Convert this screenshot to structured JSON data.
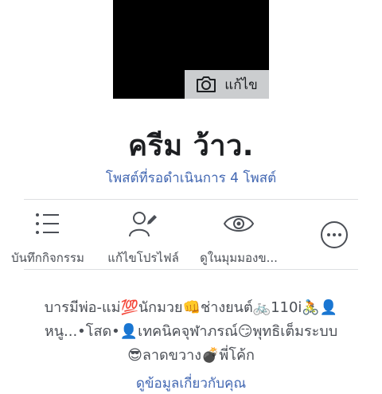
{
  "profile": {
    "edit_photo_label": "แก้ไข",
    "name": "ครีม ว้าว.",
    "pending_posts": "โพสต์ที่รอดำเนินการ 4 โพสต์"
  },
  "actions": [
    {
      "label": "บันทึกกิจกรรม",
      "icon": "list-icon"
    },
    {
      "label": "แก้ไขโปรไฟล์",
      "icon": "edit-profile-icon"
    },
    {
      "label": "ดูในมุมมองข...",
      "icon": "eye-icon"
    },
    {
      "label": "",
      "icon": "more-icon"
    }
  ],
  "bio": {
    "line1": "บารมีพ่อ-แม่💯นักมวย👊ช่างยนต์🚲110i🚴👤",
    "line2": "หนู...•โสด•👤เทคนิคจุฬาภรณ์😏พุทธิเต็มระบบ",
    "line3": "😎ลาดขวาง💣พี่โค้ก"
  },
  "more_link": "ดูข้อมูลเกี่ยวกับคุณ"
}
